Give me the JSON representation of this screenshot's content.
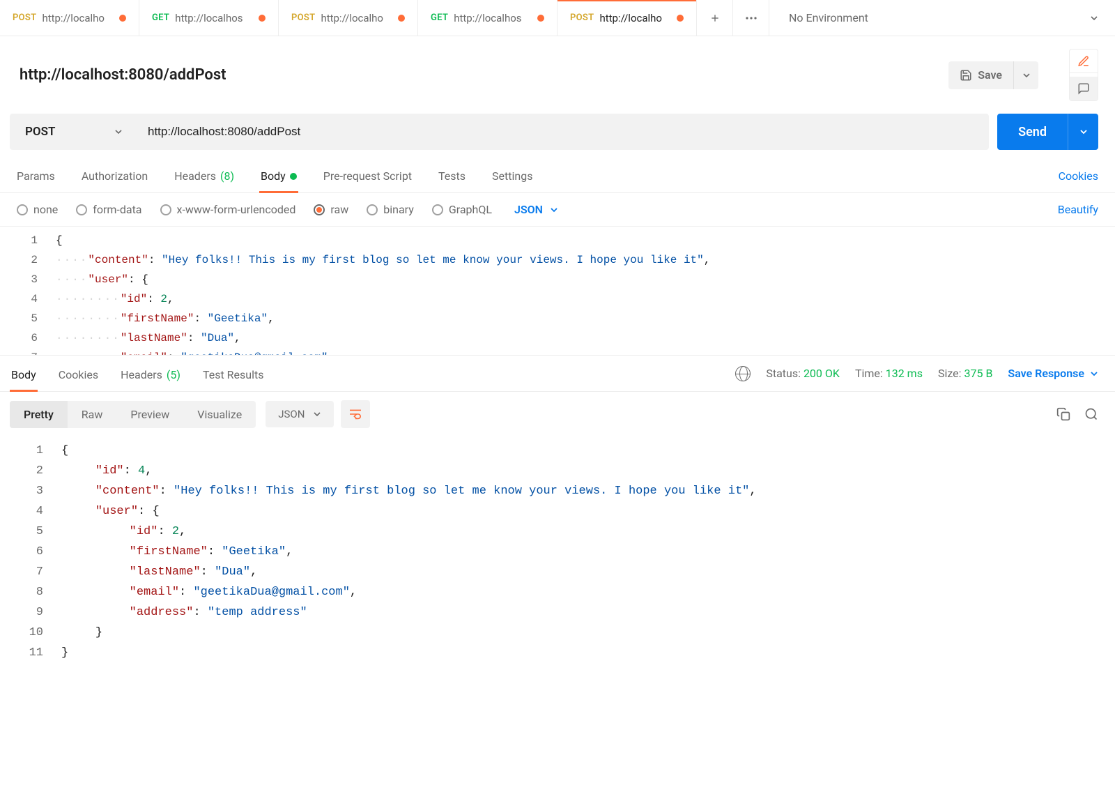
{
  "tabs": [
    {
      "method": "POST",
      "methodClass": "post",
      "title": "http://localho",
      "unsaved": true,
      "active": false
    },
    {
      "method": "GET",
      "methodClass": "get",
      "title": "http://localhos",
      "unsaved": true,
      "active": false
    },
    {
      "method": "POST",
      "methodClass": "post",
      "title": "http://localho",
      "unsaved": true,
      "active": false
    },
    {
      "method": "GET",
      "methodClass": "get",
      "title": "http://localhos",
      "unsaved": true,
      "active": false
    },
    {
      "method": "POST",
      "methodClass": "post",
      "title": "http://localho",
      "unsaved": true,
      "active": true
    }
  ],
  "environment": "No Environment",
  "request": {
    "title": "http://localhost:8080/addPost",
    "method": "POST",
    "url": "http://localhost:8080/addPost",
    "save_label": "Save"
  },
  "subtabs": {
    "params": "Params",
    "auth": "Authorization",
    "headers": "Headers",
    "headers_count": "(8)",
    "body": "Body",
    "prerequest": "Pre-request Script",
    "tests": "Tests",
    "settings": "Settings",
    "cookies": "Cookies"
  },
  "body_types": {
    "none": "none",
    "formdata": "form-data",
    "urlencoded": "x-www-form-urlencoded",
    "raw": "raw",
    "binary": "binary",
    "graphql": "GraphQL",
    "raw_lang": "JSON",
    "beautify": "Beautify"
  },
  "request_body_lines": [
    [
      {
        "t": "brace",
        "v": "{"
      }
    ],
    [
      {
        "t": "ws",
        "v": "····"
      },
      {
        "t": "key",
        "v": "\"content\""
      },
      {
        "t": "punc",
        "v": ":·"
      },
      {
        "t": "str",
        "v": "\"Hey·folks!!·This·is·my·first·blog·so·let·me·know·your·views.·I·hope·you·like·it\""
      },
      {
        "t": "punc",
        "v": ","
      }
    ],
    [
      {
        "t": "ws",
        "v": "····"
      },
      {
        "t": "key",
        "v": "\"user\""
      },
      {
        "t": "punc",
        "v": ":·"
      },
      {
        "t": "brace",
        "v": "{"
      }
    ],
    [
      {
        "t": "ws",
        "v": "········"
      },
      {
        "t": "key",
        "v": "\"id\""
      },
      {
        "t": "punc",
        "v": ":·"
      },
      {
        "t": "num",
        "v": "2"
      },
      {
        "t": "punc",
        "v": ","
      }
    ],
    [
      {
        "t": "ws",
        "v": "········"
      },
      {
        "t": "key",
        "v": "\"firstName\""
      },
      {
        "t": "punc",
        "v": ":·"
      },
      {
        "t": "str",
        "v": "\"Geetika\""
      },
      {
        "t": "punc",
        "v": ","
      }
    ],
    [
      {
        "t": "ws",
        "v": "········"
      },
      {
        "t": "key",
        "v": "\"lastName\""
      },
      {
        "t": "punc",
        "v": ":·"
      },
      {
        "t": "str",
        "v": "\"Dua\""
      },
      {
        "t": "punc",
        "v": ","
      }
    ],
    [
      {
        "t": "ws",
        "v": "········"
      },
      {
        "t": "key",
        "v": "\"email\""
      },
      {
        "t": "punc",
        "v": ":·"
      },
      {
        "t": "str",
        "v": "\"geetikaDua@gmail.com\""
      }
    ]
  ],
  "send_label": "Send",
  "response": {
    "tabs": {
      "body": "Body",
      "cookies": "Cookies",
      "headers": "Headers",
      "headers_count": "(5)",
      "tests": "Test Results"
    },
    "status_label": "Status:",
    "status_value": "200 OK",
    "time_label": "Time:",
    "time_value": "132 ms",
    "size_label": "Size:",
    "size_value": "375 B",
    "save_response": "Save Response",
    "view_tabs": {
      "pretty": "Pretty",
      "raw": "Raw",
      "preview": "Preview",
      "visualize": "Visualize"
    },
    "fmt": "JSON"
  },
  "response_body_lines": [
    [
      {
        "t": "brace",
        "v": "{"
      }
    ],
    [
      {
        "t": "ws",
        "v": "    "
      },
      {
        "t": "key",
        "v": "\"id\""
      },
      {
        "t": "punc",
        "v": ": "
      },
      {
        "t": "num",
        "v": "4"
      },
      {
        "t": "punc",
        "v": ","
      }
    ],
    [
      {
        "t": "ws",
        "v": "    "
      },
      {
        "t": "key",
        "v": "\"content\""
      },
      {
        "t": "punc",
        "v": ": "
      },
      {
        "t": "str",
        "v": "\"Hey folks!! This is my first blog so let me know your views. I hope you like it\""
      },
      {
        "t": "punc",
        "v": ","
      }
    ],
    [
      {
        "t": "ws",
        "v": "    "
      },
      {
        "t": "key",
        "v": "\"user\""
      },
      {
        "t": "punc",
        "v": ": "
      },
      {
        "t": "brace",
        "v": "{"
      }
    ],
    [
      {
        "t": "ws",
        "v": "        "
      },
      {
        "t": "key",
        "v": "\"id\""
      },
      {
        "t": "punc",
        "v": ": "
      },
      {
        "t": "num",
        "v": "2"
      },
      {
        "t": "punc",
        "v": ","
      }
    ],
    [
      {
        "t": "ws",
        "v": "        "
      },
      {
        "t": "key",
        "v": "\"firstName\""
      },
      {
        "t": "punc",
        "v": ": "
      },
      {
        "t": "str",
        "v": "\"Geetika\""
      },
      {
        "t": "punc",
        "v": ","
      }
    ],
    [
      {
        "t": "ws",
        "v": "        "
      },
      {
        "t": "key",
        "v": "\"lastName\""
      },
      {
        "t": "punc",
        "v": ": "
      },
      {
        "t": "str",
        "v": "\"Dua\""
      },
      {
        "t": "punc",
        "v": ","
      }
    ],
    [
      {
        "t": "ws",
        "v": "        "
      },
      {
        "t": "key",
        "v": "\"email\""
      },
      {
        "t": "punc",
        "v": ": "
      },
      {
        "t": "str",
        "v": "\"geetikaDua@gmail.com\""
      },
      {
        "t": "punc",
        "v": ","
      }
    ],
    [
      {
        "t": "ws",
        "v": "        "
      },
      {
        "t": "key",
        "v": "\"address\""
      },
      {
        "t": "punc",
        "v": ": "
      },
      {
        "t": "str",
        "v": "\"temp address\""
      }
    ],
    [
      {
        "t": "ws",
        "v": "    "
      },
      {
        "t": "brace",
        "v": "}"
      }
    ],
    [
      {
        "t": "brace",
        "v": "}"
      }
    ]
  ]
}
